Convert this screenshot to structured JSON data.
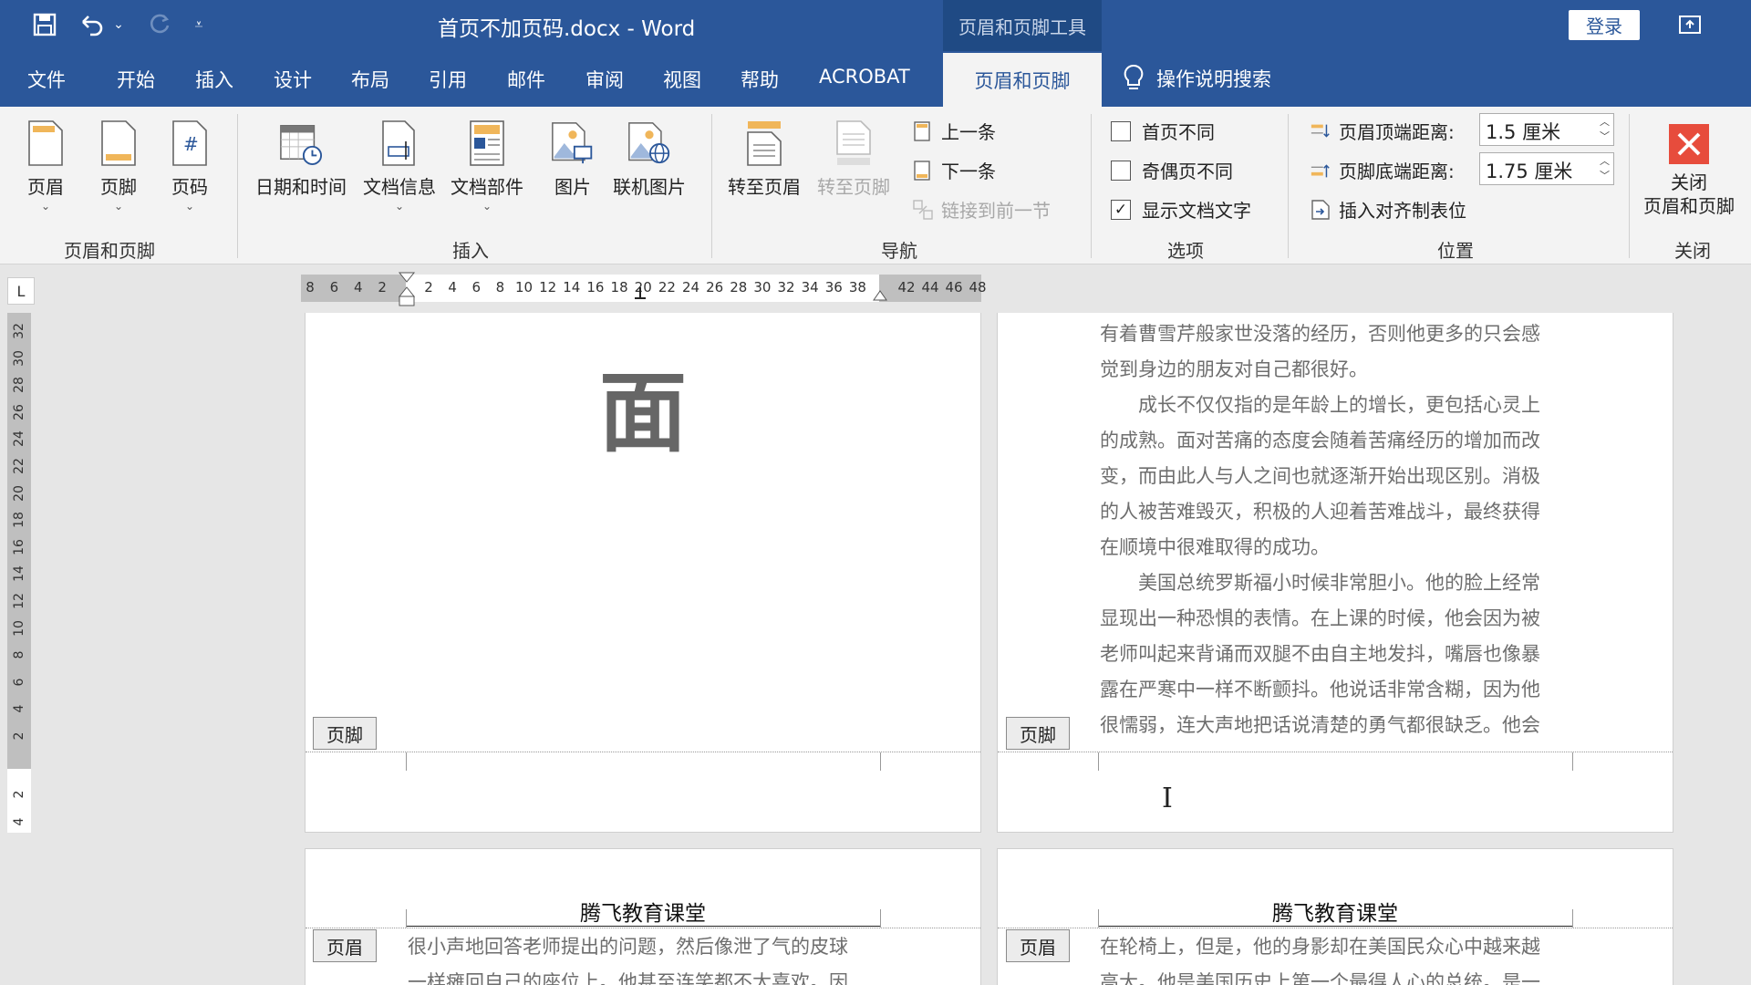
{
  "window": {
    "doc_title": "首页不加页码.docx - Word",
    "context_tab_title": "页眉和页脚工具",
    "login_label": "登录"
  },
  "tabs": [
    "文件",
    "开始",
    "插入",
    "设计",
    "布局",
    "引用",
    "邮件",
    "审阅",
    "视图",
    "帮助",
    "ACROBAT"
  ],
  "active_tab": "页眉和页脚",
  "tell_me": "操作说明搜索",
  "ribbon": {
    "header_footer_group": {
      "label": "页眉和页脚",
      "header": "页眉",
      "footer": "页脚",
      "page_number": "页码"
    },
    "insert_group": {
      "label": "插入",
      "date_time": "日期和时间",
      "doc_info": "文档信息",
      "quick_parts": "文档部件",
      "pictures": "图片",
      "online_pictures": "联机图片"
    },
    "nav_group": {
      "label": "导航",
      "goto_header": "转至页眉",
      "goto_footer": "转至页脚",
      "previous": "上一条",
      "next": "下一条",
      "link_previous": "链接到前一节"
    },
    "options_group": {
      "label": "选项",
      "different_first_page": "首页不同",
      "different_odd_even": "奇偶页不同",
      "show_doc_text": "显示文档文字",
      "different_first_page_checked": false,
      "different_odd_even_checked": false,
      "show_doc_text_checked": true
    },
    "position_group": {
      "label": "位置",
      "header_top_label": "页眉顶端距离:",
      "header_top_value": "1.5 厘米",
      "footer_bottom_label": "页脚底端距离:",
      "footer_bottom_value": "1.75 厘米",
      "insert_align_tab": "插入对齐制表位"
    },
    "close_group": {
      "label": "关闭",
      "close_line1": "关闭",
      "close_line2": "页眉和页脚"
    }
  },
  "ruler": {
    "corner": "L",
    "h_numbers": [
      "8",
      "6",
      "4",
      "2",
      "2",
      "4",
      "6",
      "8",
      "10",
      "12",
      "14",
      "16",
      "18",
      "20",
      "22",
      "24",
      "26",
      "28",
      "30",
      "32",
      "34",
      "36",
      "38",
      "42",
      "44",
      "46",
      "48"
    ],
    "v_numbers": [
      "32",
      "30",
      "28",
      "26",
      "24",
      "22",
      "20",
      "18",
      "16",
      "14",
      "12",
      "10",
      "8",
      "6",
      "4",
      "2",
      "2",
      "4"
    ]
  },
  "pages": {
    "page1": {
      "big_glyph": "面",
      "footer_tag": "页脚"
    },
    "page2": {
      "lines": [
        "有着曹雪芹般家世没落的经历，否则他更多的只会感",
        "觉到身边的朋友对自己都很好。",
        "　　成长不仅仅指的是年龄上的增长，更包括心灵上",
        "的成熟。面对苦痛的态度会随着苦痛经历的增加而改",
        "变，而由此人与人之间也就逐渐开始出现区别。消极",
        "的人被苦难毁灭，积极的人迎着苦难战斗，最终获得",
        "在顺境中很难取得的成功。",
        "　　美国总统罗斯福小时候非常胆小。他的脸上经常",
        "显现出一种恐惧的表情。在上课的时候，他会因为被",
        "老师叫起来背诵而双腿不由自主地发抖，嘴唇也像暴",
        "露在严寒中一样不断颤抖。他说话非常含糊，因为他",
        "很懦弱，连大声地把话说清楚的勇气都很缺乏。他会"
      ],
      "footer_tag": "页脚"
    },
    "page3": {
      "header_text": "腾飞教育课堂",
      "header_tag": "页眉",
      "lines": [
        "很小声地回答老师提出的问题，然后像泄了气的皮球",
        "一样瘫回自己的座位上。他甚至连笑都不太喜欢。因"
      ]
    },
    "page4": {
      "header_text": "腾飞教育课堂",
      "header_tag": "页眉",
      "lines": [
        "在轮椅上，但是，他的身影却在美国民众心中越来越",
        "高大。他是美国历史上第一个最得人心的总统。是一"
      ]
    }
  },
  "colors": {
    "brand_blue": "#2b579a",
    "close_red": "#e74c3c"
  }
}
